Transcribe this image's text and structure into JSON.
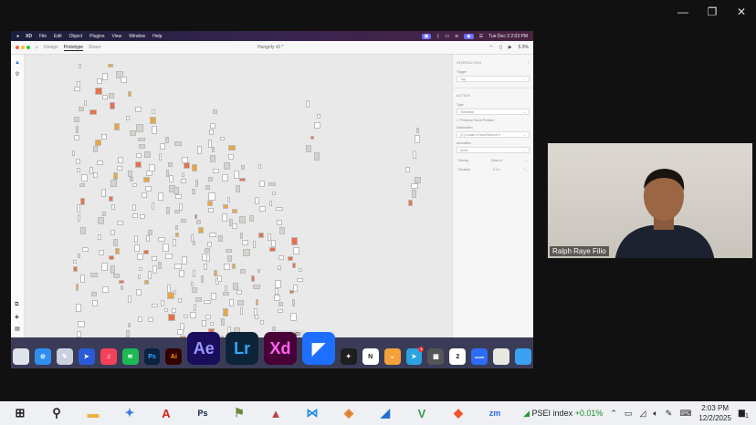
{
  "window_controls": {
    "minimize": "—",
    "maximize": "❐",
    "close": "✕"
  },
  "mac_menubar": {
    "apple": "",
    "items": [
      "XD",
      "File",
      "Edit",
      "Object",
      "Plugins",
      "View",
      "Window",
      "Help"
    ],
    "datetime": "Tue Dec 2  2:03 PM"
  },
  "xd": {
    "tabs": [
      "Design",
      "Prototype",
      "Share"
    ],
    "active_tab": "Prototype",
    "doc_title": "Hungrily v5 *",
    "zoom": "5.3%",
    "panel": {
      "interaction_title": "INTERACTION",
      "trigger_label": "Trigger",
      "trigger_value": "Tap",
      "action_title": "ACTION",
      "type_label": "Type",
      "type_value": "Transition",
      "preserve_scroll": "Preserve Scroll Position",
      "destination_label": "Destination",
      "destination_value": "(C) Locate a Store/Branch 5",
      "animation_label": "Animation",
      "animation_value": "None",
      "easing_label": "Easing",
      "easing_value": "Ease-in",
      "duration_label": "Duration",
      "duration_value": "0.3 s"
    },
    "tooltip": "Adobe XD"
  },
  "dock": {
    "apps": [
      {
        "name": "launchpad",
        "label": "",
        "color": "#dfe3ea"
      },
      {
        "name": "safari",
        "label": "⊘",
        "color": "#2f8ff0"
      },
      {
        "name": "preview",
        "label": "✎",
        "color": "#c9d0e0"
      },
      {
        "name": "copilot",
        "label": "➤",
        "color": "#2a5bd7"
      },
      {
        "name": "music",
        "label": "♫",
        "color": "#f5425a"
      },
      {
        "name": "spotify",
        "label": "≋",
        "color": "#1db954"
      },
      {
        "name": "photoshop",
        "label": "Ps",
        "color": "#0b2340"
      },
      {
        "name": "illustrator",
        "label": "Ai",
        "color": "#330000"
      },
      {
        "name": "after-effects",
        "label": "Ae",
        "color": "#1a0d5c",
        "big": true
      },
      {
        "name": "lightroom",
        "label": "Lr",
        "color": "#0d2438",
        "big": true
      },
      {
        "name": "adobe-xd",
        "label": "Xd",
        "color": "#470137",
        "big": true
      },
      {
        "name": "framer",
        "label": "◤",
        "color": "#1e6fff",
        "big": true
      },
      {
        "name": "figma",
        "label": "✦",
        "color": "#1e1e1e"
      },
      {
        "name": "notion",
        "label": "N",
        "color": "#ffffff"
      },
      {
        "name": "sketch-like",
        "label": "◒",
        "color": "#f5a13a"
      },
      {
        "name": "telegram",
        "label": "➤",
        "color": "#2aa3e0",
        "badge": "1"
      },
      {
        "name": "calculator",
        "label": "▦",
        "color": "#555"
      },
      {
        "name": "calendar",
        "label": "2",
        "color": "#ffffff"
      },
      {
        "name": "zoom",
        "label": "zoom",
        "color": "#2d6cf6"
      },
      {
        "name": "notes-stack",
        "label": "",
        "color": "#e8e8e0"
      },
      {
        "name": "finder-partial",
        "label": "",
        "color": "#3aa0f0"
      }
    ]
  },
  "video": {
    "participant_name": "Ralph Raye Filio"
  },
  "taskbar": {
    "apps": [
      {
        "name": "start",
        "glyph": "⊞",
        "color": "#222"
      },
      {
        "name": "search",
        "glyph": "⚲",
        "color": "#222"
      },
      {
        "name": "file-explorer",
        "glyph": "▬",
        "color": "#e8b23a"
      },
      {
        "name": "app-star",
        "glyph": "✦",
        "color": "#3a7be0"
      },
      {
        "name": "acrobat",
        "glyph": "A",
        "color": "#d4271b"
      },
      {
        "name": "photoshop",
        "glyph": "Ps",
        "color": "#0b2340"
      },
      {
        "name": "map-tool",
        "glyph": "⚑",
        "color": "#6a8a3a"
      },
      {
        "name": "paint-tool",
        "glyph": "▲",
        "color": "#b44"
      },
      {
        "name": "vscode",
        "glyph": "⋈",
        "color": "#1f88e0"
      },
      {
        "name": "capture-tool",
        "glyph": "◈",
        "color": "#e07a20"
      },
      {
        "name": "shark-app",
        "glyph": "◢",
        "color": "#1f6fd0"
      },
      {
        "name": "vs-app",
        "glyph": "V",
        "color": "#3a9a4a"
      },
      {
        "name": "brave",
        "glyph": "◆",
        "color": "#f0542a"
      },
      {
        "name": "zoom",
        "glyph": "zm",
        "color": "#2d6cf6"
      }
    ],
    "widget": {
      "label": "PSEI index",
      "change": "+0.01%"
    },
    "time": "2:03 PM",
    "date": "12/2/2025",
    "notifications": "1"
  }
}
